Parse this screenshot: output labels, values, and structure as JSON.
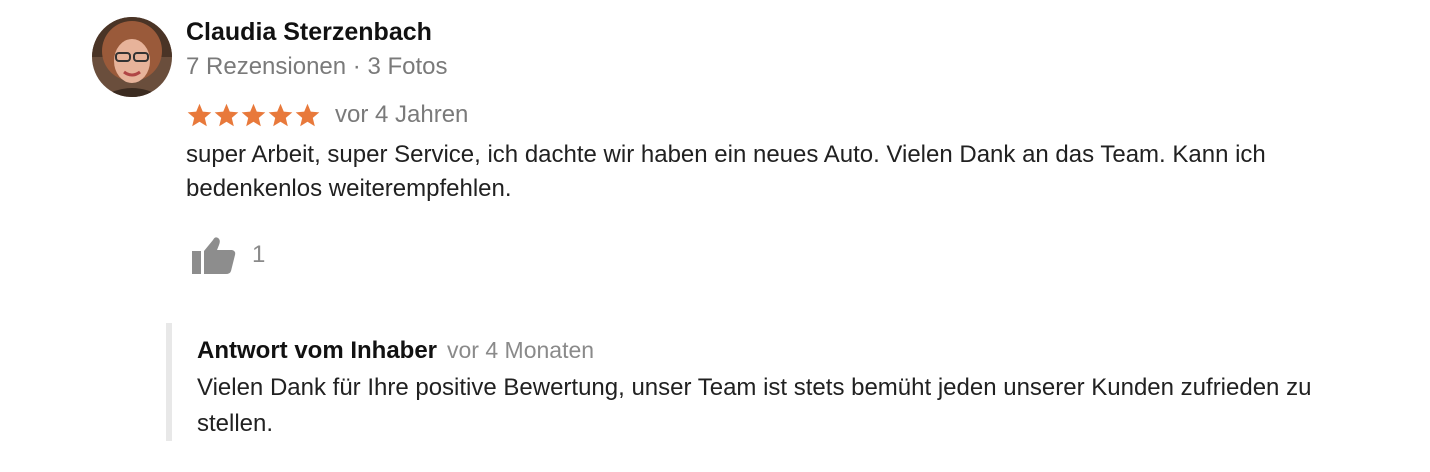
{
  "reviewer": {
    "name": "Claudia Sterzenbach",
    "meta": "7 Rezensionen · 3 Fotos",
    "avatar_icon": "user-photo-avatar"
  },
  "rating": {
    "stars": 5,
    "max_stars": 5,
    "star_color": "#e8793b"
  },
  "review": {
    "date": "vor 4 Jahren",
    "text": "super Arbeit, super Service, ich dachte wir haben ein neues Auto. Vielen Dank an das Team. Kann ich bedenkenlos weiterempfehlen."
  },
  "like": {
    "icon": "thumbs-up-icon",
    "count": "1"
  },
  "owner_response": {
    "title": "Antwort vom Inhaber",
    "date": "vor 4 Monaten",
    "text": "Vielen Dank für Ihre positive Bewertung, unser Team ist stets bemüht jeden unserer Kunden zufrieden zu stellen."
  }
}
